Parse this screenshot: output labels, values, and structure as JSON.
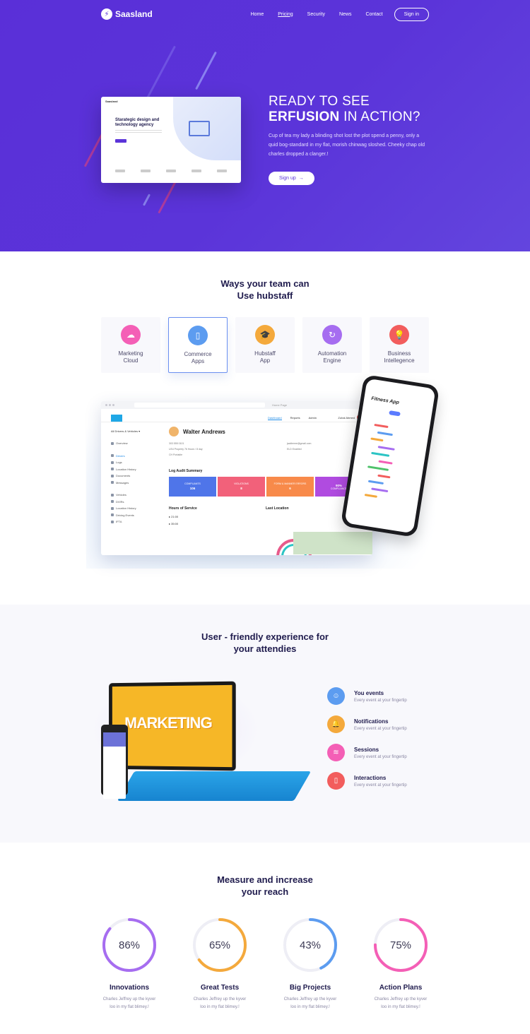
{
  "nav": {
    "logo": "Saasland",
    "links": [
      "Home",
      "Pricing",
      "Security",
      "News",
      "Contact"
    ],
    "active_link": "Pricing",
    "signin": "Sign in"
  },
  "hero": {
    "title_line1": "READY TO SEE",
    "title_brand": "ERFUSION",
    "title_rest": "IN ACTION?",
    "paragraph": "Cup of tea my lady a blinding shot lost the plot spend a penny, only a quid bog-standard in my flat, morish chinwag sloshed. Cheeky chap old charles dropped a clanger.!",
    "signup": "Sign up",
    "mock": {
      "title": "Starategic design and technology agency"
    }
  },
  "ways": {
    "title_line1": "Ways your team can",
    "title_line2": "Use hubstaff",
    "cards": [
      {
        "label_line1": "Marketing",
        "label_line2": "Cloud",
        "icon": "cloud-upload-icon",
        "color": "#f45fb6"
      },
      {
        "label_line1": "Commerce",
        "label_line2": "Apps",
        "icon": "tablet-icon",
        "color": "#5c9cf0"
      },
      {
        "label_line1": "Hubstaff",
        "label_line2": "App",
        "icon": "graduation-cap-icon",
        "color": "#f4a93c"
      },
      {
        "label_line1": "Automation",
        "label_line2": "Engine",
        "icon": "refresh-icon",
        "color": "#a66df0"
      },
      {
        "label_line1": "Business",
        "label_line2": "Intellegence",
        "icon": "lightbulb-icon",
        "color": "#f25d5d"
      }
    ],
    "active_card": 1
  },
  "dashboard": {
    "home": "Home Page",
    "breadcrumb": "Driver ▸ Walter Andrews",
    "tabs": [
      "Dashboard",
      "Reports",
      "Admin"
    ],
    "user": "Zuhal Ahmed",
    "side_select": "All Drivers & Vehicles ▾",
    "side_items": [
      "Overview",
      "Drivers",
      "Logs",
      "Location History",
      "Documents",
      "Messages",
      "Vehicles",
      "DVIRs",
      "Location History",
      "Driving Events",
      "IFTA"
    ],
    "name": "Walter Andrews",
    "info": [
      "303 555 0101",
      "jwalterme@gmail.com",
      "US4 Property 76 Hours / 8 day",
      "ELD Enabled",
      "CH Portable"
    ],
    "log_title": "Log Audit Summary",
    "stats": [
      {
        "label": "COMPLIANTS",
        "value": "106",
        "color": "#4f75e9"
      },
      {
        "label": "VIOLATIONS",
        "value": "8",
        "color": "#f2617a"
      },
      {
        "label": "FORM & MANNER ERRORS",
        "value": "6",
        "color": "#f88a4a"
      },
      {
        "label": "COMPLIANCE",
        "value": "90%",
        "color": "#b04be0"
      }
    ],
    "hours_title": "Hours of Service",
    "last_location": "Last Location",
    "hours": [
      "21:00",
      "35:00"
    ],
    "phone_title": "Fitness App"
  },
  "friendly": {
    "title_line1": "User - friendly experience for",
    "title_line2": "your attendies",
    "marketing": "MARKETING",
    "features": [
      {
        "title": "You events",
        "sub": "Every event at your fingertip",
        "icon": "user-icon",
        "color": "#5c9cf0"
      },
      {
        "title": "Notifications",
        "sub": "Every event at your fingertip",
        "icon": "bell-icon",
        "color": "#f4a93c"
      },
      {
        "title": "Sessions",
        "sub": "Every event at your fingertip",
        "icon": "layers-icon",
        "color": "#f45fb6"
      },
      {
        "title": "Interactions",
        "sub": "Every event at your fingertip",
        "icon": "phone-icon",
        "color": "#f25d5d"
      }
    ]
  },
  "measure": {
    "title_line1": "Measure and increase",
    "title_line2": "your reach",
    "items": [
      {
        "value": "86%",
        "pct": 0.86,
        "title": "Innovations",
        "desc_line1": "Charles Jeffrey up the kyver",
        "desc_line2": "loo in my flat blimey.!",
        "color": "#a66df0"
      },
      {
        "value": "65%",
        "pct": 0.65,
        "title": "Great Tests",
        "desc_line1": "Charles Jeffrey up the kyver",
        "desc_line2": "loo in my flat blimey.!",
        "color": "#f4a93c"
      },
      {
        "value": "43%",
        "pct": 0.43,
        "title": "Big Projects",
        "desc_line1": "Charles Jeffrey up the kyver",
        "desc_line2": "loo in my flat blimey.!",
        "color": "#5c9cf0"
      },
      {
        "value": "75%",
        "pct": 0.75,
        "title": "Action Plans",
        "desc_line1": "Charles Jeffrey up the kyver",
        "desc_line2": "loo in my flat blimey.!",
        "color": "#f45fb6"
      }
    ]
  }
}
